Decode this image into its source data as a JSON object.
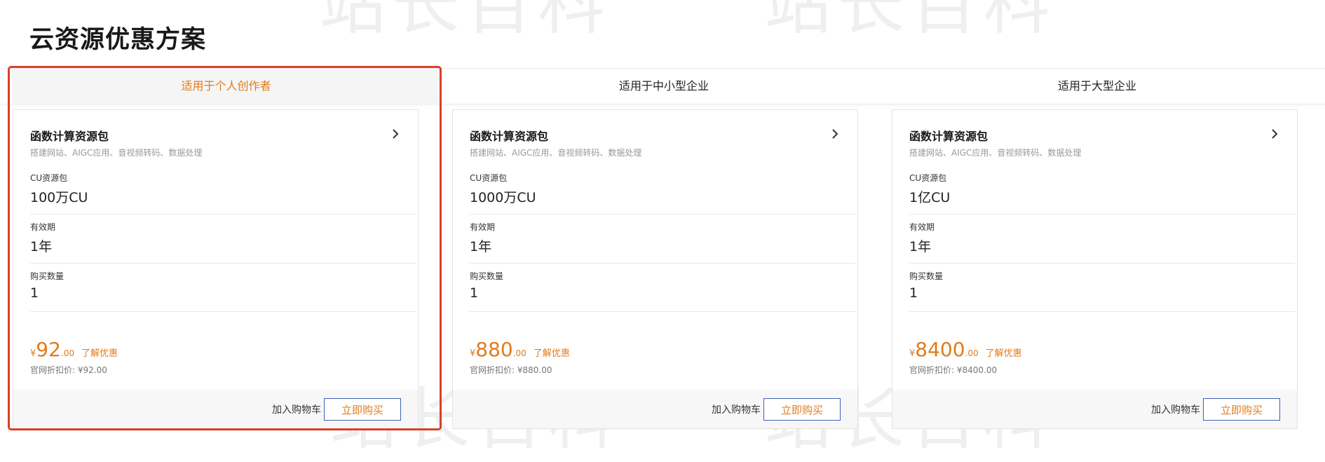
{
  "page": {
    "title": "云资源优惠方案"
  },
  "tabs": [
    {
      "label": "适用于个人创作者",
      "active": true
    },
    {
      "label": "适用于中小型企业",
      "active": false
    },
    {
      "label": "适用于大型企业",
      "active": false
    }
  ],
  "cards": [
    {
      "title": "函数计算资源包",
      "subtitle": "搭建网站、AIGC应用、音视频转码、数据处理",
      "cu_label": "CU资源包",
      "cu_value": "100万CU",
      "period_label": "有效期",
      "period_value": "1年",
      "qty_label": "购买数量",
      "qty_value": "1",
      "currency": "¥",
      "price_int": "92",
      "price_dec": ".00",
      "promo_link": "了解优惠",
      "official_price": "官网折扣价: ¥92.00",
      "cart_label": "加入购物车",
      "buy_label": "立即购买"
    },
    {
      "title": "函数计算资源包",
      "subtitle": "搭建网站、AIGC应用、音视频转码、数据处理",
      "cu_label": "CU资源包",
      "cu_value": "1000万CU",
      "period_label": "有效期",
      "period_value": "1年",
      "qty_label": "购买数量",
      "qty_value": "1",
      "currency": "¥",
      "price_int": "880",
      "price_dec": ".00",
      "promo_link": "了解优惠",
      "official_price": "官网折扣价: ¥880.00",
      "cart_label": "加入购物车",
      "buy_label": "立即购买"
    },
    {
      "title": "函数计算资源包",
      "subtitle": "搭建网站、AIGC应用、音视频转码、数据处理",
      "cu_label": "CU资源包",
      "cu_value": "1亿CU",
      "period_label": "有效期",
      "period_value": "1年",
      "qty_label": "购买数量",
      "qty_value": "1",
      "currency": "¥",
      "price_int": "8400",
      "price_dec": ".00",
      "promo_link": "了解优惠",
      "official_price": "官网折扣价: ¥8400.00",
      "cart_label": "加入购物车",
      "buy_label": "立即购买"
    }
  ],
  "watermark": {
    "text": "站长百科"
  },
  "colors": {
    "accent": "#e07c1c",
    "highlight": "#d9402b",
    "button_border": "#3f5fb5"
  },
  "icons": {
    "card_arrow": "chevron-right-icon"
  }
}
